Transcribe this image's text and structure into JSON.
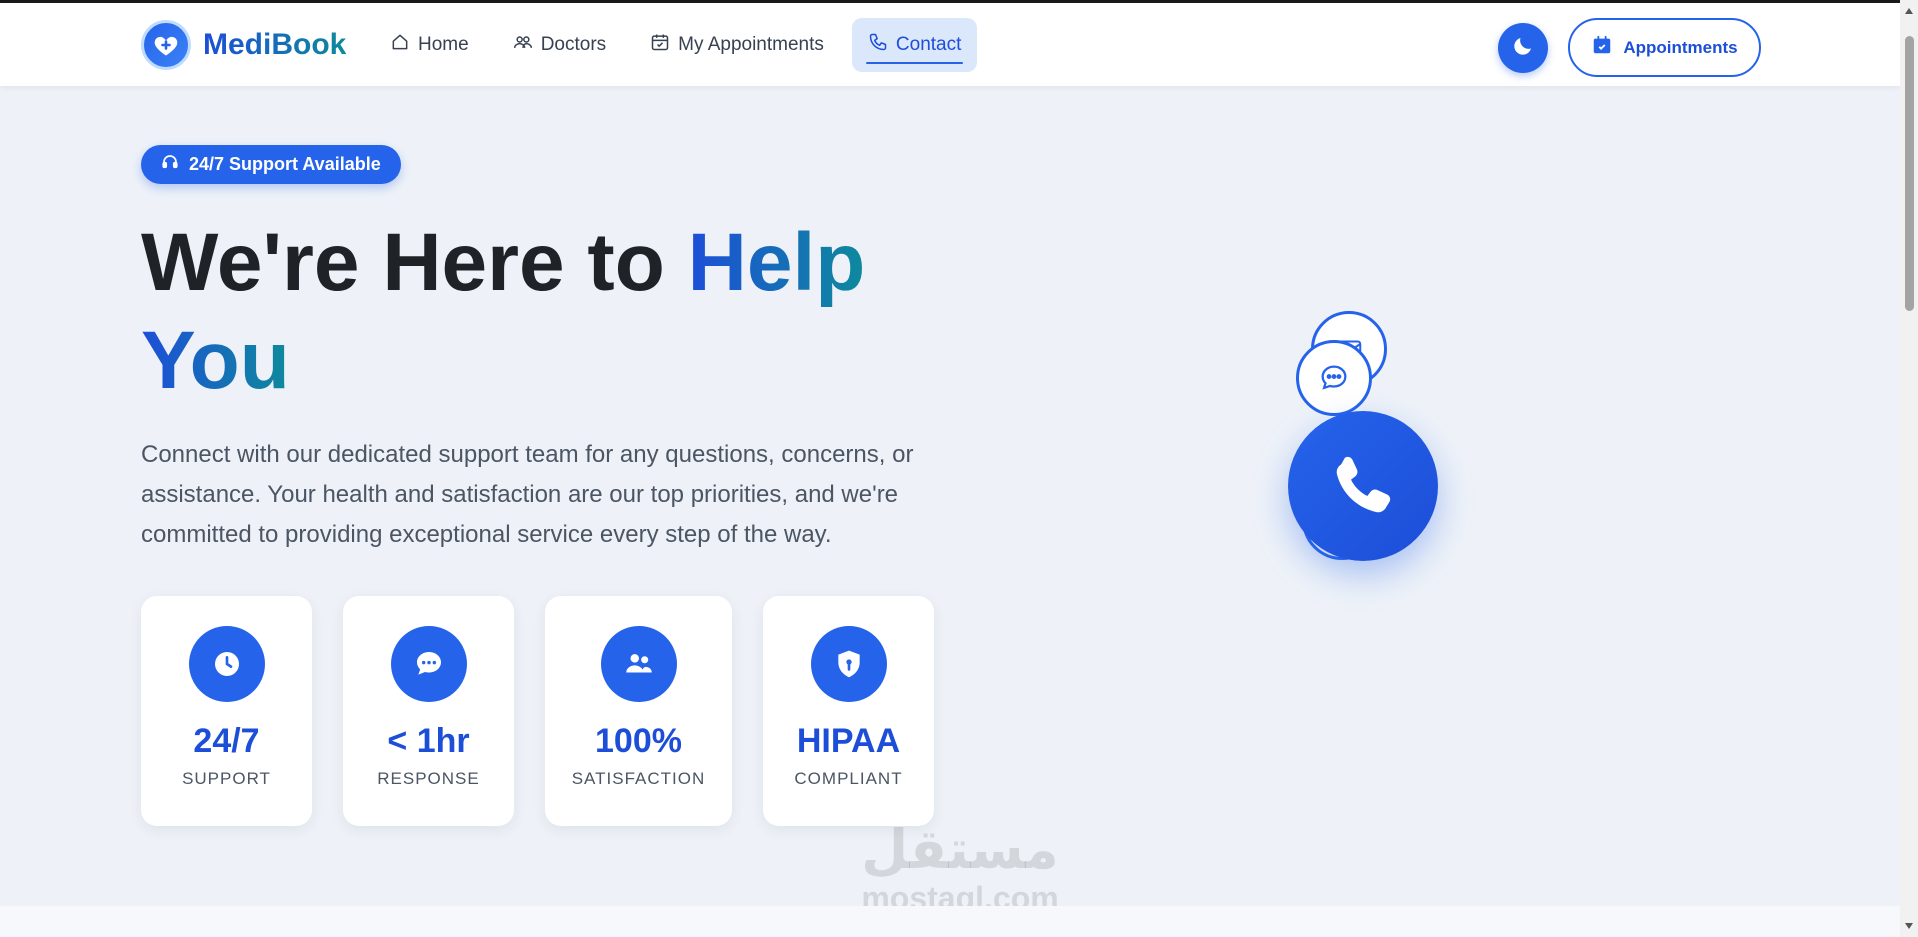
{
  "brand": {
    "name": "MediBook",
    "icon": "heart-medical-icon"
  },
  "nav": {
    "items": [
      {
        "label": "Home",
        "icon": "home-icon"
      },
      {
        "label": "Doctors",
        "icon": "users-icon"
      },
      {
        "label": "My Appointments",
        "icon": "calendar-check-icon"
      },
      {
        "label": "Contact",
        "icon": "phone-icon",
        "active": true
      }
    ],
    "theme_toggle_icon": "moon-icon",
    "appointments_button": {
      "label": "Appointments",
      "icon": "calendar-icon"
    }
  },
  "hero": {
    "badge": {
      "label": "24/7 Support Available",
      "icon": "headset-icon"
    },
    "title_part1": "We're Here to ",
    "title_highlight_1": "Help",
    "title_highlight_2": "You",
    "description": "Connect with our dedicated support team for any questions, concerns, or assistance. Your health and satisfaction are our top priorities, and we're committed to providing exceptional service every step of the way."
  },
  "stats": [
    {
      "value": "24/7",
      "label": "SUPPORT",
      "icon": "clock-icon"
    },
    {
      "value": "< 1hr",
      "label": "RESPONSE",
      "icon": "chat-icon"
    },
    {
      "value": "100%",
      "label": "SATISFACTION",
      "icon": "users-icon"
    },
    {
      "value": "HIPAA",
      "label": "COMPLIANT",
      "icon": "shield-lock-icon"
    }
  ],
  "illustration": {
    "main_icon": "phone-icon",
    "floating_icons": [
      "envelope-icon",
      "chat-bubble-icon"
    ]
  },
  "watermark": {
    "arabic": "مستقل",
    "latin": "mostaql.com"
  },
  "colors": {
    "primary": "#2563eb",
    "primary_dark": "#1d4ed8",
    "teal": "#0e8a9c",
    "background": "#eef2f8"
  }
}
